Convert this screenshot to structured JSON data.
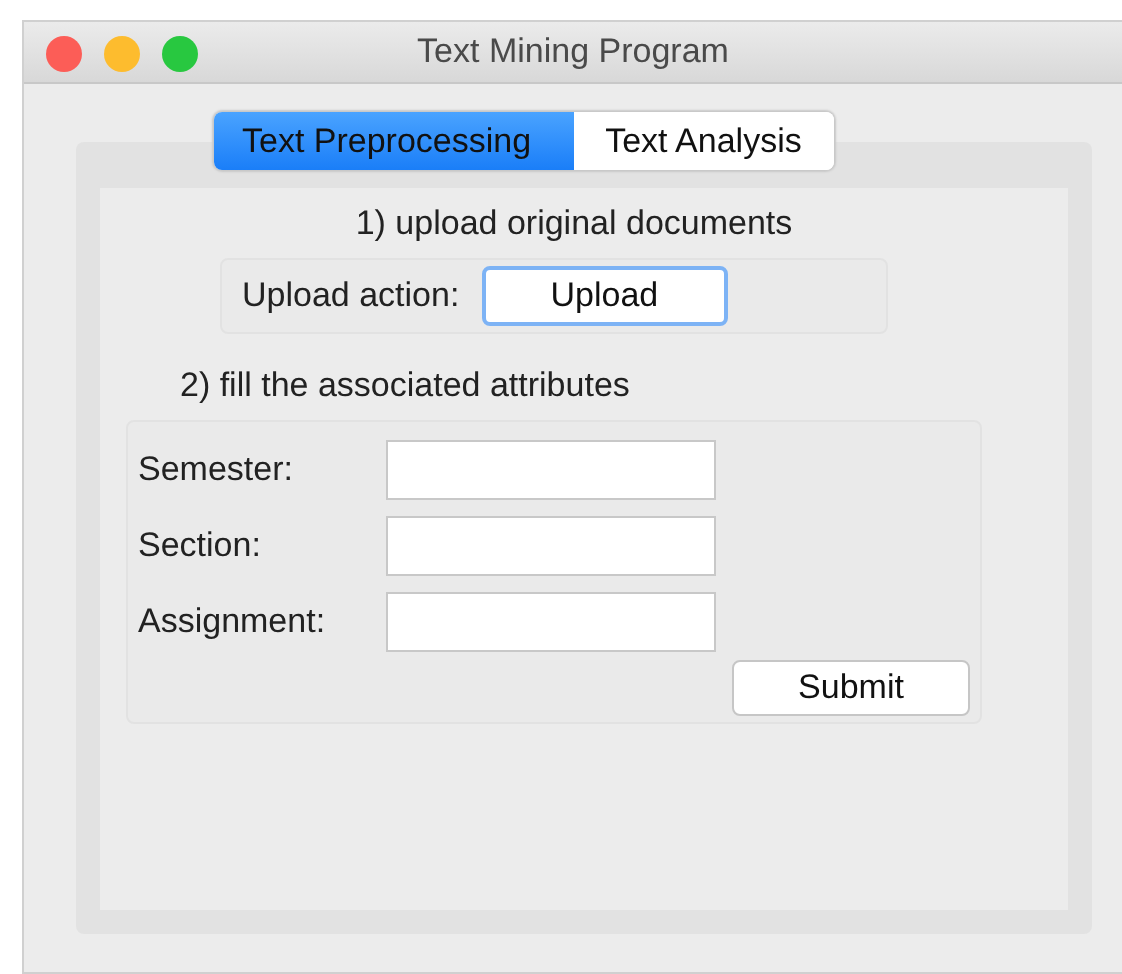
{
  "window": {
    "title": "Text Mining Program"
  },
  "tabs": [
    {
      "label": "Text Preprocessing",
      "selected": true
    },
    {
      "label": "Text Analysis",
      "selected": false
    }
  ],
  "upload_section": {
    "heading": "1) upload original documents",
    "label": "Upload action:",
    "button": "Upload"
  },
  "attributes_section": {
    "heading": "2) fill the associated attributes",
    "fields": [
      {
        "label": "Semester:"
      },
      {
        "label": "Section:"
      },
      {
        "label": "Assignment:"
      }
    ],
    "button": "Submit"
  }
}
